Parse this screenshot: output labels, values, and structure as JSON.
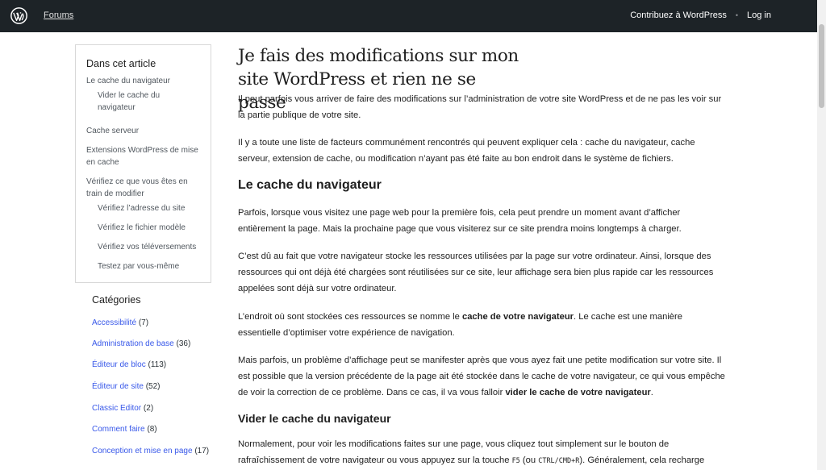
{
  "topbar": {
    "forums": "Forums",
    "contribute": "Contribuez à WordPress",
    "separator": "•",
    "login": "Log in"
  },
  "toc": {
    "title": "Dans cet article",
    "items": [
      "Le cache du navigateur",
      "Vider le cache du navigateur",
      "Cache serveur",
      "Extensions WordPress de mise en cache",
      "Vérifiez ce que vous êtes en train de modifier",
      "Vérifiez l’adresse du site",
      "Vérifiez le fichier modèle",
      "Vérifiez vos téléversements",
      "Testez par vous-même"
    ]
  },
  "categories": {
    "title": "Catégories",
    "items": [
      {
        "name": "Accessibilité",
        "count": "(7)"
      },
      {
        "name": "Administration de base",
        "count": "(36)"
      },
      {
        "name": "Éditeur de bloc",
        "count": "(113)"
      },
      {
        "name": "Éditeur de site",
        "count": "(52)"
      },
      {
        "name": "Classic Editor",
        "count": "(2)"
      },
      {
        "name": "Comment faire",
        "count": "(8)"
      },
      {
        "name": "Conception et mise en page",
        "count": "(17)"
      }
    ]
  },
  "article": {
    "title_line1": "Je fais des modifications sur mon",
    "title_line2": "site WordPress et rien ne se passe",
    "intro1": "Il peut parfois vous arriver de faire des modifications sur l’administration de votre site WordPress et de ne pas les voir sur la partie publique de votre site.",
    "intro2": "Il y a toute une liste de facteurs communément rencontrés qui peuvent expliquer cela : cache du navigateur, cache serveur, extension de cache, ou modification n’ayant pas été faite au bon endroit dans le système de fichiers.",
    "h2_cache": "Le cache du navigateur",
    "p_cache1": "Parfois, lorsque vous visitez une page web pour la première fois, cela peut prendre un moment avant d’afficher entièrement la page. Mais la prochaine page que vous visiterez sur ce site prendra moins longtemps à charger.",
    "p_cache2": "C’est dû au fait que votre navigateur stocke les ressources utilisées par la page sur votre ordinateur. Ainsi, lorsque des ressources qui ont déjà été chargées sont réutilisées sur ce site, leur affichage sera bien plus rapide car les ressources appelées sont déjà sur votre ordinateur.",
    "p_cache3_a": "L’endroit où sont stockées ces ressources se nomme le ",
    "p_cache3_b": "cache de votre navigateur",
    "p_cache3_c": ". Le cache est une manière essentielle d’optimiser votre expérience de navigation.",
    "p_cache4_a": "Mais parfois, un problème d’affichage peut se manifester après que vous ayez fait une petite modification sur votre site. Il est possible que la version précédente de la page ait été stockée dans le cache de votre navigateur, ce qui vous empêche de voir la correction de ce problème. Dans ce cas, il va vous falloir ",
    "p_cache4_b": "vider le cache de votre navigateur",
    "p_cache4_c": ".",
    "h3_clear": "Vider le cache du navigateur",
    "p_clear_a": "Normalement, pour voir les modifications faites sur une page, vous cliquez tout simplement sur le bouton de rafraîchissement de votre navigateur ou vous appuyez sur la touche ",
    "p_clear_key1": "F5",
    "p_clear_b": " (ou ",
    "p_clear_key2": "CTRL/CMD+R",
    "p_clear_c": "). Généralement, cela recharge"
  }
}
